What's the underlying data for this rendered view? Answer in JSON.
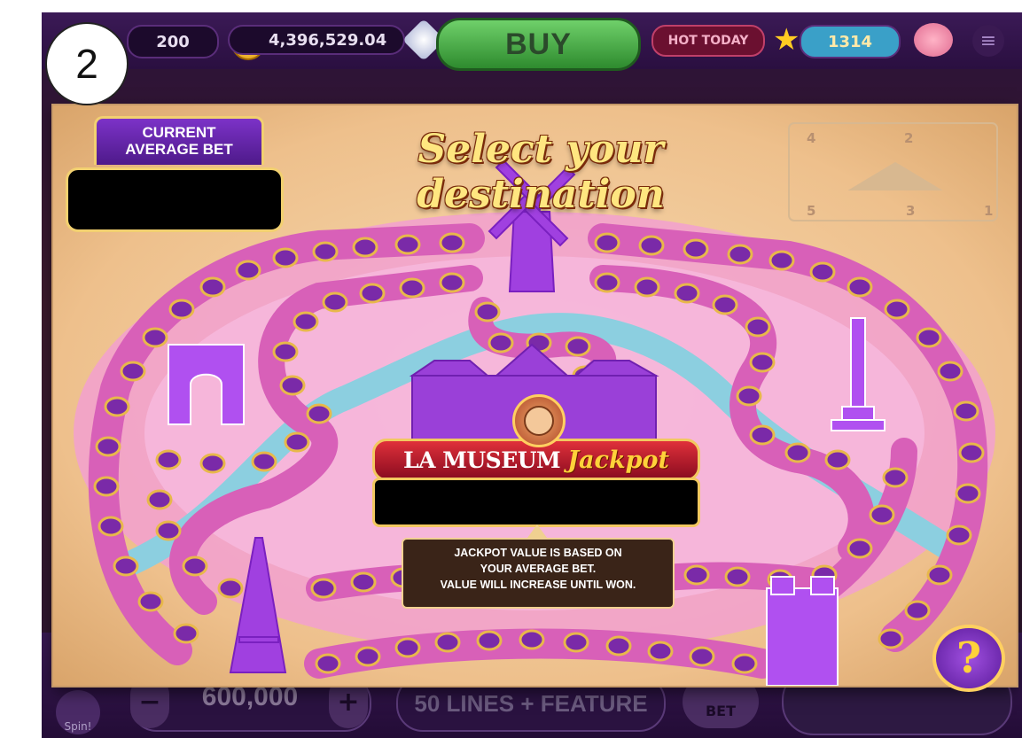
{
  "step_badge": "2",
  "top_bar": {
    "bet_display": "200",
    "coin_symbol": "$",
    "balance": "4,396,529.04",
    "buy_label": "BUY",
    "hot_today_label": "HOT TODAY",
    "level_value": "1314",
    "menu_glyph": "≡",
    "icons": [
      "coin-icon",
      "diamond-icon",
      "star-icon",
      "piggy-bank-icon",
      "menu-icon"
    ]
  },
  "map_panel": {
    "current_average_bet_label": "CURRENT\nAVERAGE BET",
    "title": "Select your destination",
    "stamp_numbers": [
      "4",
      "2",
      "5",
      "3",
      "1"
    ],
    "jackpot_name": "LA MUSEUM",
    "jackpot_word": "Jackpot",
    "tooltip_lines": [
      "JACKPOT VALUE IS BASED ON",
      "YOUR AVERAGE BET.",
      "VALUE WILL INCREASE UNTIL WON."
    ],
    "help_glyph": "?",
    "landmarks": [
      "windmill-icon",
      "arc-de-triomphe-icon",
      "louvre-icon",
      "column-icon",
      "eiffel-tower-icon",
      "notre-dame-icon"
    ],
    "colors": {
      "path": "#e070c0",
      "river": "#8ccfe0",
      "token": "#7a2aa8",
      "token_rim": "#e8b84a",
      "landmark": "#a040e0"
    }
  },
  "bottom_bar": {
    "spin_label": "Spin!",
    "minus_label": "−",
    "plus_label": "+",
    "bet_value": "600,000",
    "lines_label": "50 LINES + FEATURE",
    "max_bet_label": "BET"
  }
}
